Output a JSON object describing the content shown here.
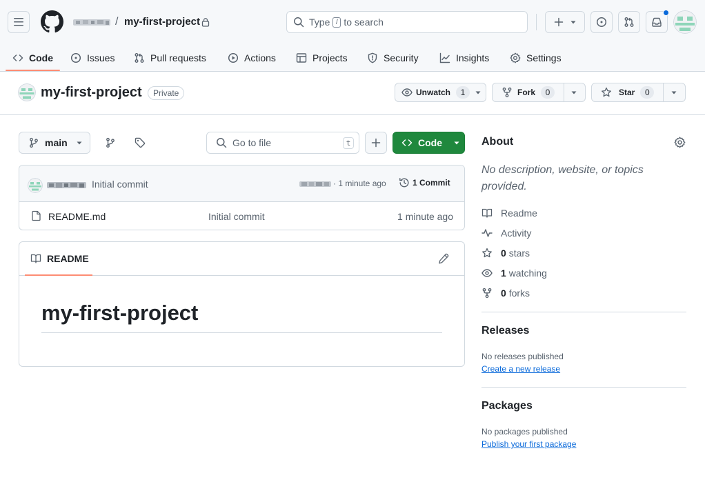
{
  "header": {
    "breadcrumb_separator": "/",
    "repo_name": "my-first-project",
    "search_text_before": "Type",
    "search_key": "/",
    "search_text_after": "to search"
  },
  "tabs": [
    {
      "label": "Code",
      "icon": "code-icon",
      "active": true
    },
    {
      "label": "Issues",
      "icon": "issue-icon"
    },
    {
      "label": "Pull requests",
      "icon": "git-pull-request-icon"
    },
    {
      "label": "Actions",
      "icon": "play-icon"
    },
    {
      "label": "Projects",
      "icon": "table-icon"
    },
    {
      "label": "Security",
      "icon": "shield-icon"
    },
    {
      "label": "Insights",
      "icon": "graph-icon"
    },
    {
      "label": "Settings",
      "icon": "gear-icon"
    }
  ],
  "repo": {
    "title": "my-first-project",
    "visibility": "Private",
    "unwatch_label": "Unwatch",
    "watch_count": "1",
    "fork_label": "Fork",
    "fork_count": "0",
    "star_label": "Star",
    "star_count": "0"
  },
  "toolbar": {
    "branch": "main",
    "goto_placeholder": "Go to file",
    "goto_key": "t",
    "code_label": "Code"
  },
  "commit": {
    "message": "Initial commit",
    "time": "· 1 minute ago",
    "count_label": "1 Commit"
  },
  "files": [
    {
      "name": "README.md",
      "message": "Initial commit",
      "time": "1 minute ago"
    }
  ],
  "readme": {
    "tab_label": "README",
    "heading": "my-first-project"
  },
  "about": {
    "title": "About",
    "description": "No description, website, or topics provided.",
    "items": [
      {
        "icon": "book-icon",
        "count": "",
        "label": "Readme"
      },
      {
        "icon": "pulse-icon",
        "count": "",
        "label": "Activity"
      },
      {
        "icon": "star-icon",
        "count": "0",
        "label": "stars"
      },
      {
        "icon": "eye-icon",
        "count": "1",
        "label": "watching"
      },
      {
        "icon": "fork-icon",
        "count": "0",
        "label": "forks"
      }
    ]
  },
  "releases": {
    "title": "Releases",
    "empty_text": "No releases published",
    "link": "Create a new release"
  },
  "packages": {
    "title": "Packages",
    "empty_text": "No packages published",
    "link": "Publish your first package"
  },
  "colors": {
    "accent": "#fd8c73",
    "primary_button": "#1f883d",
    "link": "#0969da",
    "notification": "#0969da",
    "avatar_green": "#8ed5b9"
  }
}
